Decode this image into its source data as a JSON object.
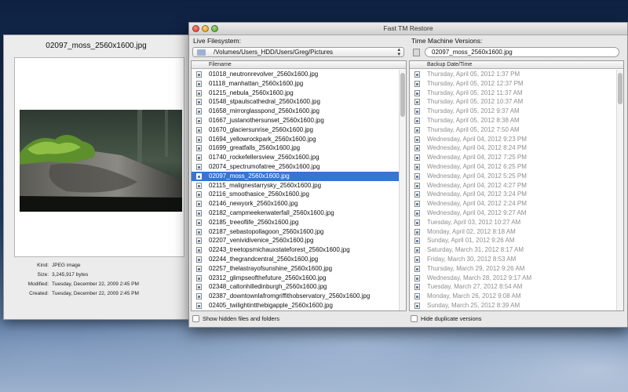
{
  "info_panel": {
    "filename": "02097_moss_2560x1600.jpg",
    "meta": [
      {
        "key": "Kind:",
        "value": "JPEG image"
      },
      {
        "key": "Size:",
        "value": "3,245,917 bytes"
      },
      {
        "key": "Modified:",
        "value": "Tuesday, December 22, 2009 2:45 PM"
      },
      {
        "key": "Created:",
        "value": "Tuesday, December 22, 2009 2:45 PM"
      }
    ]
  },
  "window": {
    "title": "Fast TM Restore",
    "live_label": "Live Filesystem:",
    "versions_label": "Time Machine Versions:",
    "path": "/Volumes/Users_HDD/Users/Greg/Pictures",
    "version_search": "02097_moss_2560x1600.jpg",
    "files_header": "Filename",
    "versions_header": "Backup Date/Time",
    "show_hidden_label": "Show hidden files and folders",
    "hide_duplicate_label": "Hide duplicate versions"
  },
  "files": [
    "01018_neutronrevolver_2560x1600.jpg",
    "01118_manhattan_2560x1600.jpg",
    "01215_nebula_2560x1600.jpg",
    "01548_stpaulscathedral_2560x1600.jpg",
    "01658_mirrorglasspond_2560x1600.jpg",
    "01667_justanothersunset_2560x1600.jpg",
    "01670_glaciersunrise_2560x1600.jpg",
    "01694_yellowrockpark_2560x1600.jpg",
    "01699_greatfalls_2560x1600.jpg",
    "01740_rockefellersview_2560x1600.jpg",
    "02074_spectrumofatree_2560x1600.jpg",
    "02097_moss_2560x1600.jpg",
    "02115_malignestarrysky_2560x1600.jpg",
    "02116_smoothasice_2560x1600.jpg",
    "02146_newyork_2560x1600.jpg",
    "02182_campmeekerwaterfall_2560x1600.jpg",
    "02185_treeoflife_2560x1600.jpg",
    "02187_sebastopollagoon_2560x1600.jpg",
    "02207_venividivenice_2560x1600.jpg",
    "02243_treetopsmichauxstateforest_2560x1600.jpg",
    "02244_thegrandcentral_2560x1600.jpg",
    "02257_thelastrayofsunshine_2560x1600.jpg",
    "02312_glimpseofthefuture_2560x1600.jpg",
    "02348_caltonhilledinburgh_2560x1600.jpg",
    "02387_downtownlafromgriffithobservatory_2560x1600.jpg",
    "02405_twilightintthebigapple_2560x1600.jpg"
  ],
  "selected_file_index": 11,
  "versions": [
    "Thursday, April 05, 2012 1:37 PM",
    "Thursday, April 05, 2012 12:37 PM",
    "Thursday, April 05, 2012 11:37 AM",
    "Thursday, April 05, 2012 10:37 AM",
    "Thursday, April 05, 2012 9:37 AM",
    "Thursday, April 05, 2012 8:38 AM",
    "Thursday, April 05, 2012 7:50 AM",
    "Wednesday, April 04, 2012 9:23 PM",
    "Wednesday, April 04, 2012 8:24 PM",
    "Wednesday, April 04, 2012 7:25 PM",
    "Wednesday, April 04, 2012 6:25 PM",
    "Wednesday, April 04, 2012 5:25 PM",
    "Wednesday, April 04, 2012 4:27 PM",
    "Wednesday, April 04, 2012 3:24 PM",
    "Wednesday, April 04, 2012 2:24 PM",
    "Wednesday, April 04, 2012 9:27 AM",
    "Tuesday, April 03, 2012 10:27 AM",
    "Monday, April 02, 2012 8:18 AM",
    "Sunday, April 01, 2012 9:26 AM",
    "Saturday, March 31, 2012 8:17 AM",
    "Friday, March 30, 2012 8:53 AM",
    "Thursday, March 29, 2012 9:26 AM",
    "Wednesday, March 28, 2012 9:17 AM",
    "Tuesday, March 27, 2012 8:54 AM",
    "Monday, March 26, 2012 9:08 AM",
    "Sunday, March 25, 2012 8:39 AM"
  ]
}
